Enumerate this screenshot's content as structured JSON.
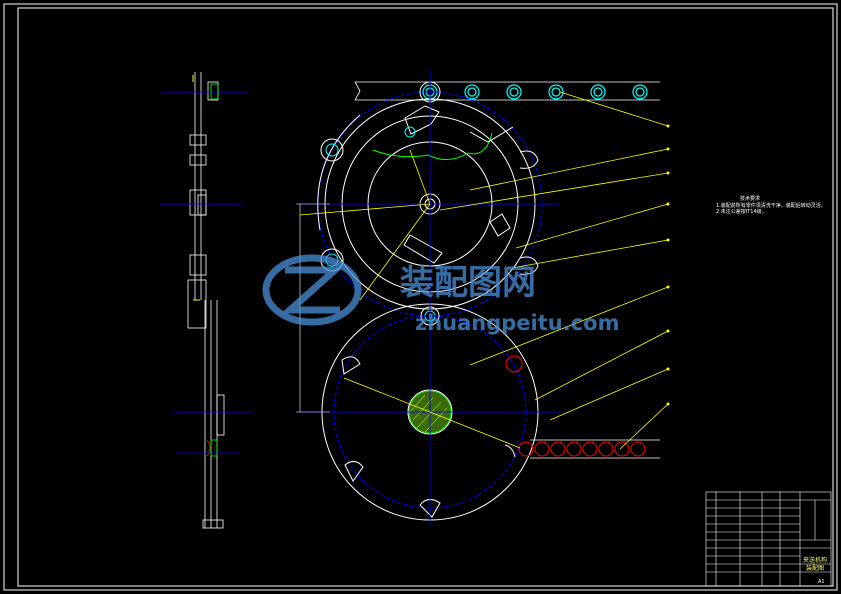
{
  "drawing": {
    "tech_note_title": "技术要求",
    "tech_note_lines": [
      "1.装配前所有零件须清洗干净，装配后转动灵活。",
      "2.未注公差按IT14级。"
    ],
    "title_block": {
      "name_line1": "夹送机构",
      "name_line2": "装配图",
      "sheet": "A1"
    }
  },
  "watermark": {
    "text": "装配图网",
    "url": "zhuangpeitu.com"
  },
  "colors": {
    "background": "#000000",
    "frame": "#ffffff",
    "centerline": "#0000ff",
    "leader": "#ffff00",
    "hidden_red": "#ff0000",
    "cyan": "#00ffff",
    "green": "#00ff00",
    "watermark": "#4a90d9"
  }
}
